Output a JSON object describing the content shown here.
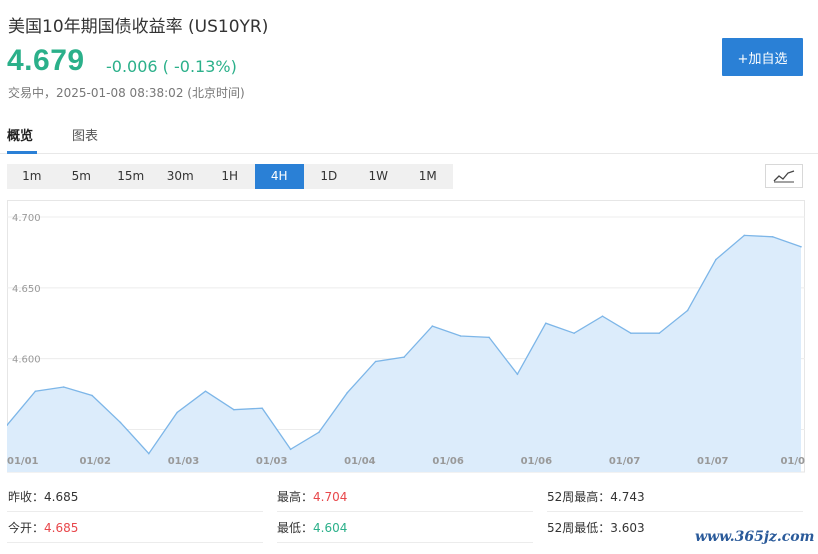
{
  "header": {
    "title": "美国10年期国债收益率  (US10YR)",
    "price": "4.679",
    "change": "-0.006 ( -0.13%)",
    "status": "交易中，2025-01-08 08:38:02 (北京时间)",
    "add_button": "+加自选"
  },
  "tabs": [
    "概览",
    "图表"
  ],
  "periods": [
    "1m",
    "5m",
    "15m",
    "30m",
    "1H",
    "4H",
    "1D",
    "1W",
    "1M"
  ],
  "active_period": "4H",
  "chart_icon": "line-chart-icon",
  "colors": {
    "accent": "#2a80d6",
    "down": "#2bb08a",
    "up": "#e8474b",
    "line": "#7db6e8",
    "fill": "#dcecfb"
  },
  "chart_data": {
    "type": "area",
    "x": [
      "01/01",
      "01/01",
      "01/01",
      "01/01",
      "01/02",
      "01/02",
      "01/02",
      "01/03",
      "01/03",
      "01/03",
      "01/03",
      "01/03",
      "01/03",
      "01/04",
      "01/04",
      "01/04",
      "01/06",
      "01/06",
      "01/06",
      "01/06",
      "01/06",
      "01/06",
      "01/06",
      "01/07",
      "01/07",
      "01/07",
      "01/07",
      "01/07",
      "01/07"
    ],
    "values": [
      4.553,
      4.577,
      4.58,
      4.574,
      4.555,
      4.533,
      4.562,
      4.577,
      4.564,
      4.565,
      4.536,
      4.548,
      4.576,
      4.598,
      4.601,
      4.623,
      4.616,
      4.615,
      4.589,
      4.625,
      4.618,
      4.63,
      4.618,
      4.618,
      4.634,
      4.67,
      4.687,
      4.686,
      4.679
    ],
    "x_tick_labels": [
      "01/01",
      "01/02",
      "01/03",
      "01/03",
      "01/04",
      "01/06",
      "01/06",
      "01/07",
      "01/07",
      "01/0"
    ],
    "y_ticks": [
      "4.550",
      "4.600",
      "4.650",
      "4.700"
    ],
    "ylim": [
      4.52,
      4.712
    ],
    "title": "",
    "xlabel": "",
    "ylabel": "",
    "grid": true
  },
  "stats": {
    "prev_close_label": "昨收：",
    "prev_close": "4.685",
    "open_label": "今开：",
    "open": "4.685",
    "high_label": "最高：",
    "high": "4.704",
    "low_label": "最低：",
    "low": "4.604",
    "w52_high_label": "52周最高：",
    "w52_high": "4.743",
    "w52_low_label": "52周最低：",
    "w52_low": "3.603"
  },
  "watermark": "www.365jz.com"
}
